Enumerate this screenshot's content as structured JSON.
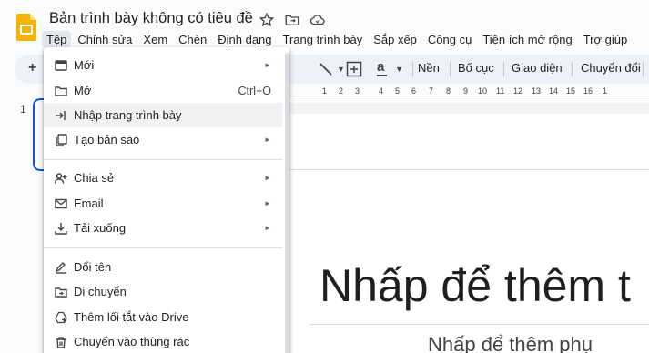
{
  "document": {
    "title": "Bản trình bày không có tiêu đề"
  },
  "menubar": [
    "Tệp",
    "Chỉnh sửa",
    "Xem",
    "Chèn",
    "Định dạng",
    "Trang trình bày",
    "Sắp xếp",
    "Công cụ",
    "Tiện ích mở rộng",
    "Trợ giúp"
  ],
  "toolbar": {
    "plus": "+",
    "font_glyph": "a",
    "background_label": "Nền",
    "layout_label": "Bố cục",
    "theme_label": "Giao diện",
    "transition_label": "Chuyển đổi"
  },
  "ruler": [
    "1",
    "2",
    "3",
    "4",
    "5",
    "6",
    "7",
    "8",
    "9",
    "10",
    "11",
    "12",
    "13",
    "14",
    "15",
    "16",
    "1"
  ],
  "slides": {
    "current_number": "1"
  },
  "slide": {
    "title_placeholder": "Nhấp để thêm t",
    "subtitle_placeholder": "Nhấp để thêm phụ"
  },
  "file_menu": {
    "items": [
      {
        "label": "Mới",
        "icon": "slides-new-icon",
        "submenu": true
      },
      {
        "label": "Mở",
        "icon": "folder-icon",
        "shortcut": "Ctrl+O"
      },
      {
        "label": "Nhập trang trình bày",
        "icon": "import-icon",
        "highlighted": true
      },
      {
        "label": "Tạo bản sao",
        "icon": "copy-icon",
        "submenu": true
      },
      {
        "label": "Chia sẻ",
        "icon": "share-person-icon",
        "submenu": true
      },
      {
        "label": "Email",
        "icon": "email-icon",
        "submenu": true
      },
      {
        "label": "Tải xuống",
        "icon": "download-icon",
        "submenu": true
      },
      {
        "label": "Đổi tên",
        "icon": "rename-icon"
      },
      {
        "label": "Di chuyển",
        "icon": "move-folder-icon"
      },
      {
        "label": "Thêm lối tắt vào Drive",
        "icon": "drive-shortcut-icon"
      },
      {
        "label": "Chuyển vào thùng rác",
        "icon": "trash-icon"
      }
    ]
  },
  "colors": {
    "accent": "#0b57d0",
    "toolbar_bg": "#edf2fa",
    "logo_yellow": "#f4b400"
  }
}
